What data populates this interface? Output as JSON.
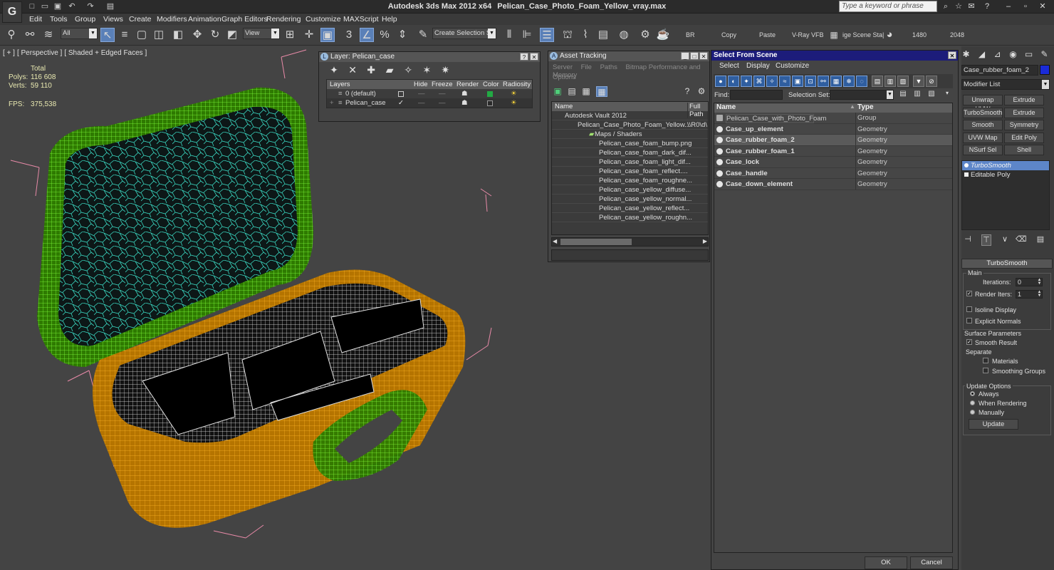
{
  "window": {
    "app_title": "Autodesk 3ds Max  2012 x64",
    "file_title": "Pelican_Case_Photo_Foam_Yellow_vray.max",
    "search_placeholder": "Type a keyword or phrase"
  },
  "menu": [
    "Edit",
    "Tools",
    "Group",
    "Views",
    "Create",
    "Modifiers",
    "Animation",
    "Graph Editors",
    "Rendering",
    "Customize",
    "MAXScript",
    "Help"
  ],
  "toolbar": {
    "selection_filter": "All",
    "ref_coord": "View",
    "named_selection_placeholder": "Create Selection Se",
    "labels": [
      "BR",
      "Copy",
      "Paste",
      "V-Ray VFB",
      "ige Scene Sta|",
      "1480",
      "2048"
    ]
  },
  "viewport": {
    "label_parts": [
      "[ + ]",
      "[ Perspective ]",
      "[ Shaded + Edged Faces ]"
    ],
    "stats": {
      "total_label": "Total",
      "polys_label": "Polys:",
      "polys": "116 608",
      "verts_label": "Verts:",
      "verts": "59 110",
      "fps_label": "FPS:",
      "fps": "375,538"
    }
  },
  "layer_panel": {
    "title": "Layer: Pelican_case",
    "columns": [
      "Layers",
      "Hide",
      "Freeze",
      "Render",
      "Color",
      "Radiosity"
    ],
    "rows": [
      {
        "name": "0 (default)"
      },
      {
        "name": "Pelican_case"
      }
    ],
    "colors": {
      "default_layer": "#22aa44",
      "pelican_layer": "#2a2a2a"
    }
  },
  "asset_panel": {
    "title": "Asset Tracking",
    "menu": [
      "Server",
      "File",
      "Paths",
      "Bitmap Performance and Memory"
    ],
    "menu2": "Options",
    "columns": [
      "Name",
      "Full Path"
    ],
    "full_path_sample": "\\\\R0\\d\\",
    "tree": [
      {
        "name": "Autodesk Vault 2012",
        "indent": 1
      },
      {
        "name": "Pelican_Case_Photo_Foam_Yellow...",
        "indent": 2,
        "path": "\\\\R0\\d\\"
      },
      {
        "name": "Maps / Shaders",
        "indent": 3
      },
      {
        "name": "Pelican_case_foam_bump.png",
        "indent": 4
      },
      {
        "name": "Pelican_case_foam_dark_dif...",
        "indent": 4
      },
      {
        "name": "Pelican_case_foam_light_dif...",
        "indent": 4
      },
      {
        "name": "Pelican_case_foam_reflect....",
        "indent": 4
      },
      {
        "name": "Pelican_case_foam_roughne...",
        "indent": 4
      },
      {
        "name": "Pelican_case_yellow_diffuse...",
        "indent": 4
      },
      {
        "name": "Pelican_case_yellow_normal...",
        "indent": 4
      },
      {
        "name": "Pelican_case_yellow_reflect...",
        "indent": 4
      },
      {
        "name": "Pelican_case_yellow_roughn...",
        "indent": 4
      }
    ]
  },
  "select_panel": {
    "title": "Select From Scene",
    "menu": [
      "Select",
      "Display",
      "Customize"
    ],
    "find_label": "Find:",
    "selection_set_label": "Selection Set:",
    "columns": [
      "Name",
      "Type"
    ],
    "rows": [
      {
        "name": "Pelican_Case_with_Photo_Foam",
        "type": "Group",
        "group": true
      },
      {
        "name": "Case_up_element",
        "type": "Geometry"
      },
      {
        "name": "Case_rubber_foam_2",
        "type": "Geometry",
        "selected": true
      },
      {
        "name": "Case_rubber_foam_1",
        "type": "Geometry"
      },
      {
        "name": "Case_lock",
        "type": "Geometry"
      },
      {
        "name": "Case_handle",
        "type": "Geometry"
      },
      {
        "name": "Case_down_element",
        "type": "Geometry"
      }
    ],
    "ok_label": "OK",
    "cancel_label": "Cancel"
  },
  "command_panel": {
    "object_name": "Case_rubber_foam_2",
    "object_color": "#1a2bd8",
    "modifier_list": "Modifier List",
    "buttons": [
      "Unwrap UVW",
      "Extrude",
      "TurboSmooth",
      "Extrude",
      "Smooth",
      "Symmetry",
      "UVW Map",
      "Edit Poly",
      "NSurf Sel",
      "Shell"
    ],
    "stack": [
      {
        "name": "TurboSmooth",
        "selected": true
      },
      {
        "name": "Editable Poly"
      }
    ],
    "rollout_title": "TurboSmooth",
    "main_label": "Main",
    "iterations_label": "Iterations:",
    "iterations": "0",
    "render_iters_label": "Render Iters:",
    "render_iters": "1",
    "isoline_label": "Isoline Display",
    "explicit_normals_label": "Explicit Normals",
    "surface_params_label": "Surface Parameters",
    "smooth_result_label": "Smooth Result",
    "separate_label": "Separate",
    "materials_label": "Materials",
    "smoothing_groups_label": "Smoothing Groups",
    "update_options_label": "Update Options",
    "always_label": "Always",
    "when_rendering_label": "When Rendering",
    "manually_label": "Manually",
    "update_button": "Update"
  }
}
